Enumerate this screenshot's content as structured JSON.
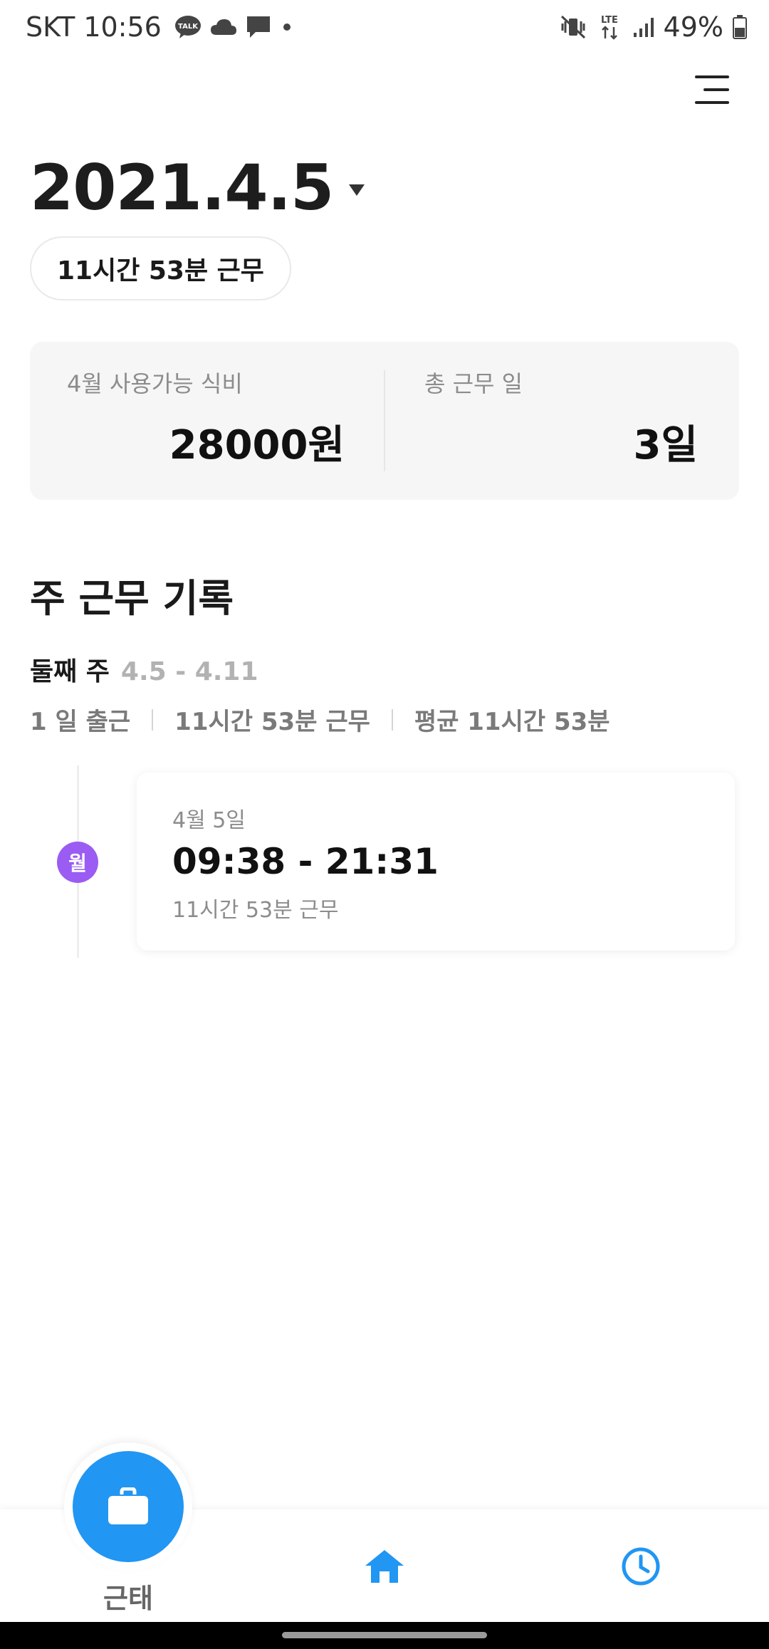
{
  "status_bar": {
    "carrier": "SKT",
    "time": "10:56",
    "talk_icon_text": "TALK",
    "network": "LTE",
    "battery": "49%"
  },
  "header": {
    "date": "2021.4.5",
    "work_duration": "11시간 53분 근무"
  },
  "summary": {
    "meal_label": "4월 사용가능 식비",
    "meal_value": "28000원",
    "days_label": "총 근무 일",
    "days_value": "3일"
  },
  "week_section": {
    "title": "주 근무 기록",
    "week_name": "둘째 주",
    "week_range": "4.5 - 4.11",
    "stats": {
      "days": "1 일 출근",
      "total": "11시간 53분 근무",
      "average": "평균 11시간 53분"
    },
    "records": [
      {
        "day_badge": "월",
        "date": "4월 5일",
        "time_range": "09:38 - 21:31",
        "duration": "11시간 53분 근무"
      }
    ]
  },
  "bottom_nav": {
    "attendance_label": "근태"
  },
  "colors": {
    "primary": "#2196f3",
    "day_badge": "#9a5cf2"
  }
}
